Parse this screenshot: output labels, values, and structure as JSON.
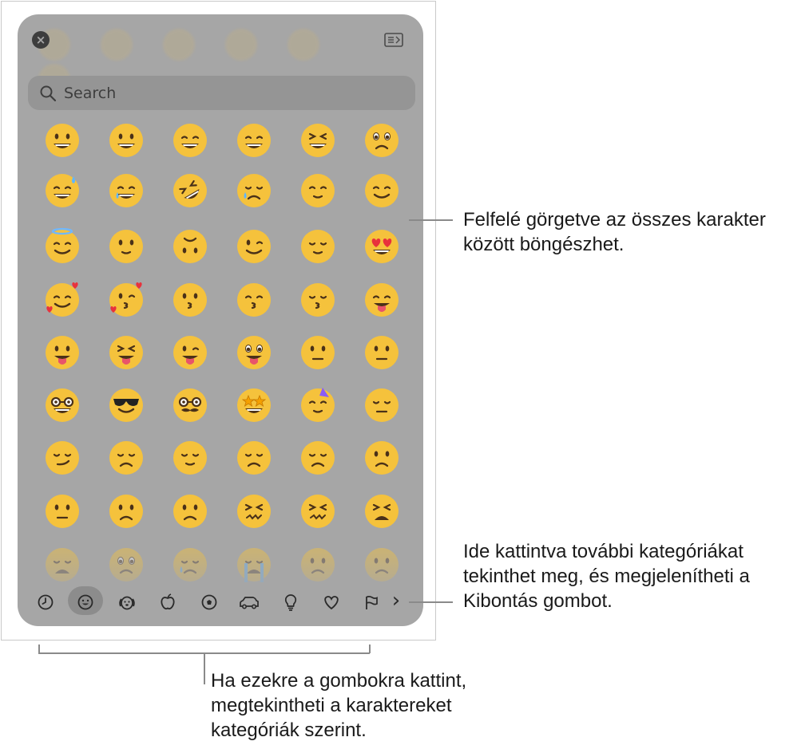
{
  "picker": {
    "search_placeholder": "Search",
    "close_label": "×",
    "next_categories_glyph": "›",
    "categories": [
      {
        "name": "recent",
        "icon": "clock-icon",
        "selected": false
      },
      {
        "name": "smileys",
        "icon": "smiley-icon",
        "selected": true
      },
      {
        "name": "animals",
        "icon": "dog-icon",
        "selected": false
      },
      {
        "name": "food",
        "icon": "apple-icon",
        "selected": false
      },
      {
        "name": "activity",
        "icon": "soccer-ball-icon",
        "selected": false
      },
      {
        "name": "travel",
        "icon": "car-icon",
        "selected": false
      },
      {
        "name": "objects",
        "icon": "lightbulb-icon",
        "selected": false
      },
      {
        "name": "symbols",
        "icon": "heart-icon",
        "selected": false
      },
      {
        "name": "flags",
        "icon": "flag-icon",
        "selected": false
      }
    ],
    "emoji_rows": [
      [
        "grinning-face",
        "grinning-face-big-eyes",
        "grinning-face-smiling-eyes",
        "beaming-face",
        "squinting-face",
        "face-holding-back-tears"
      ],
      [
        "grinning-face-sweat",
        "face-tears-of-joy",
        "rolling-on-floor-laughing",
        "crying-face",
        "smiling-face",
        "smiling-face-smiling-eyes"
      ],
      [
        "smiling-face-halo",
        "slightly-smiling-face",
        "upside-down-face",
        "winking-face",
        "relieved-face",
        "smiling-face-heart-eyes"
      ],
      [
        "smiling-face-hearts",
        "face-blowing-kiss",
        "kissing-face",
        "kissing-face-smiling-eyes",
        "kissing-face-closed-eyes",
        "face-savoring-food"
      ],
      [
        "face-with-tongue",
        "squinting-face-tongue",
        "winking-face-tongue",
        "zany-face",
        "face-raised-eyebrow",
        "face-with-monocle"
      ],
      [
        "nerd-face",
        "smiling-face-sunglasses",
        "disguised-face",
        "star-struck",
        "partying-face",
        "face-peeking"
      ],
      [
        "smirking-face",
        "unamused-face",
        "face-exhaling",
        "disappointed-face",
        "pensive-face",
        "worried-face"
      ],
      [
        "confused-face",
        "slightly-frowning-face",
        "frowning-face",
        "confounded-face",
        "persevering-face",
        "tired-face"
      ],
      [
        "weary-face",
        "pleading-face",
        "sad-relieved-face",
        "loudly-crying-face",
        "face-steam-nose",
        "angry-face"
      ]
    ]
  },
  "annotations": {
    "scroll": "Felfelé görgetve az összes karakter között böngészhet.",
    "more_categories": "Ide kattintva további kategóriákat tekinthet meg, és megjelenítheti a Kibontás gombot.",
    "category_buttons": "Ha ezekre a gombokra kattint, megtekintheti a karaktereket kategóriák szerint."
  },
  "colors": {
    "panel_bg": "#a6a6a6",
    "emoji_yellow": "#f5c23c",
    "emoji_feature": "#4a3118",
    "tongue": "#e8546a",
    "heart": "#e8323c"
  }
}
